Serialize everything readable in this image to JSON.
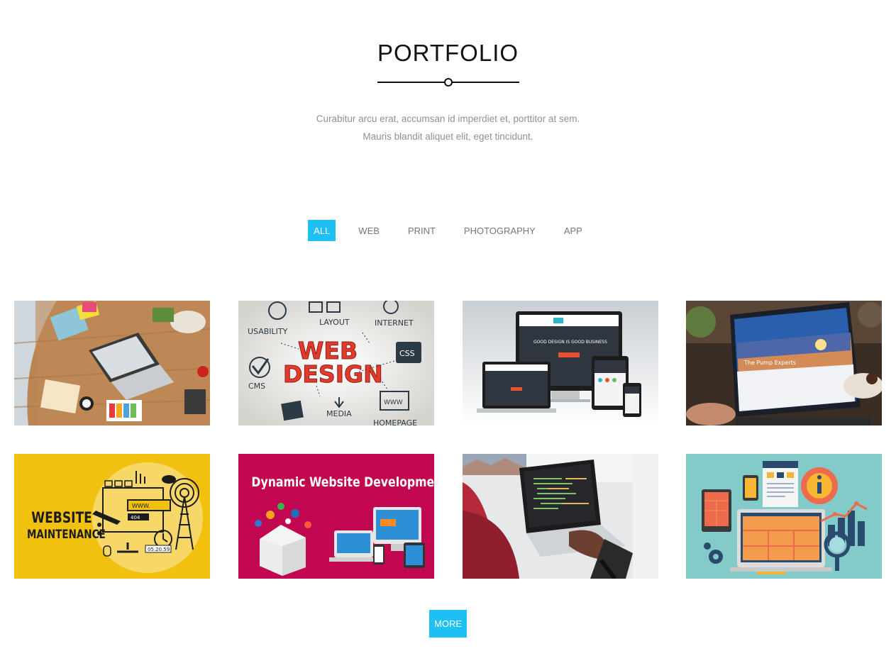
{
  "section": {
    "title": "PORTFOLIO",
    "subtitle_line1": "Curabitur arcu erat, accumsan id imperdiet et, porttitor at sem.",
    "subtitle_line2": "Mauris blandit aliquet elit, eget tincidunt."
  },
  "filters": [
    {
      "label": "ALL",
      "active": true
    },
    {
      "label": "WEB",
      "active": false
    },
    {
      "label": "PRINT",
      "active": false
    },
    {
      "label": "PHOTOGRAPHY",
      "active": false
    },
    {
      "label": "APP",
      "active": false
    }
  ],
  "tiles": [
    {
      "name": "workspace-laptop-desk-photo"
    },
    {
      "name": "web-design-concept-image",
      "labels": [
        "USABILITY",
        "LAYOUT",
        "INTERNET",
        "WEB",
        "DESIGN",
        "CSS",
        "CMS",
        "MEDIA",
        "HOMEPAGE",
        "WWW"
      ]
    },
    {
      "name": "responsive-devices-mockup",
      "labels": [
        "GOOD DESIGN IS GOOD BUSINESS"
      ]
    },
    {
      "name": "laptop-website-photo",
      "labels": [
        "The Pump Experts"
      ]
    },
    {
      "name": "website-maintenance-illustration",
      "labels": [
        "WEBSITE",
        "MAINTENANCE",
        "WWW.",
        "404",
        "05.20.59"
      ]
    },
    {
      "name": "dynamic-website-development-banner",
      "labels": [
        "Dynamic Website Development"
      ]
    },
    {
      "name": "coding-laptop-photo"
    },
    {
      "name": "app-analytics-illustration"
    }
  ],
  "more_button": "MORE",
  "colors": {
    "accent": "#1ec0f3",
    "subtitle": "#9a8d8d"
  }
}
